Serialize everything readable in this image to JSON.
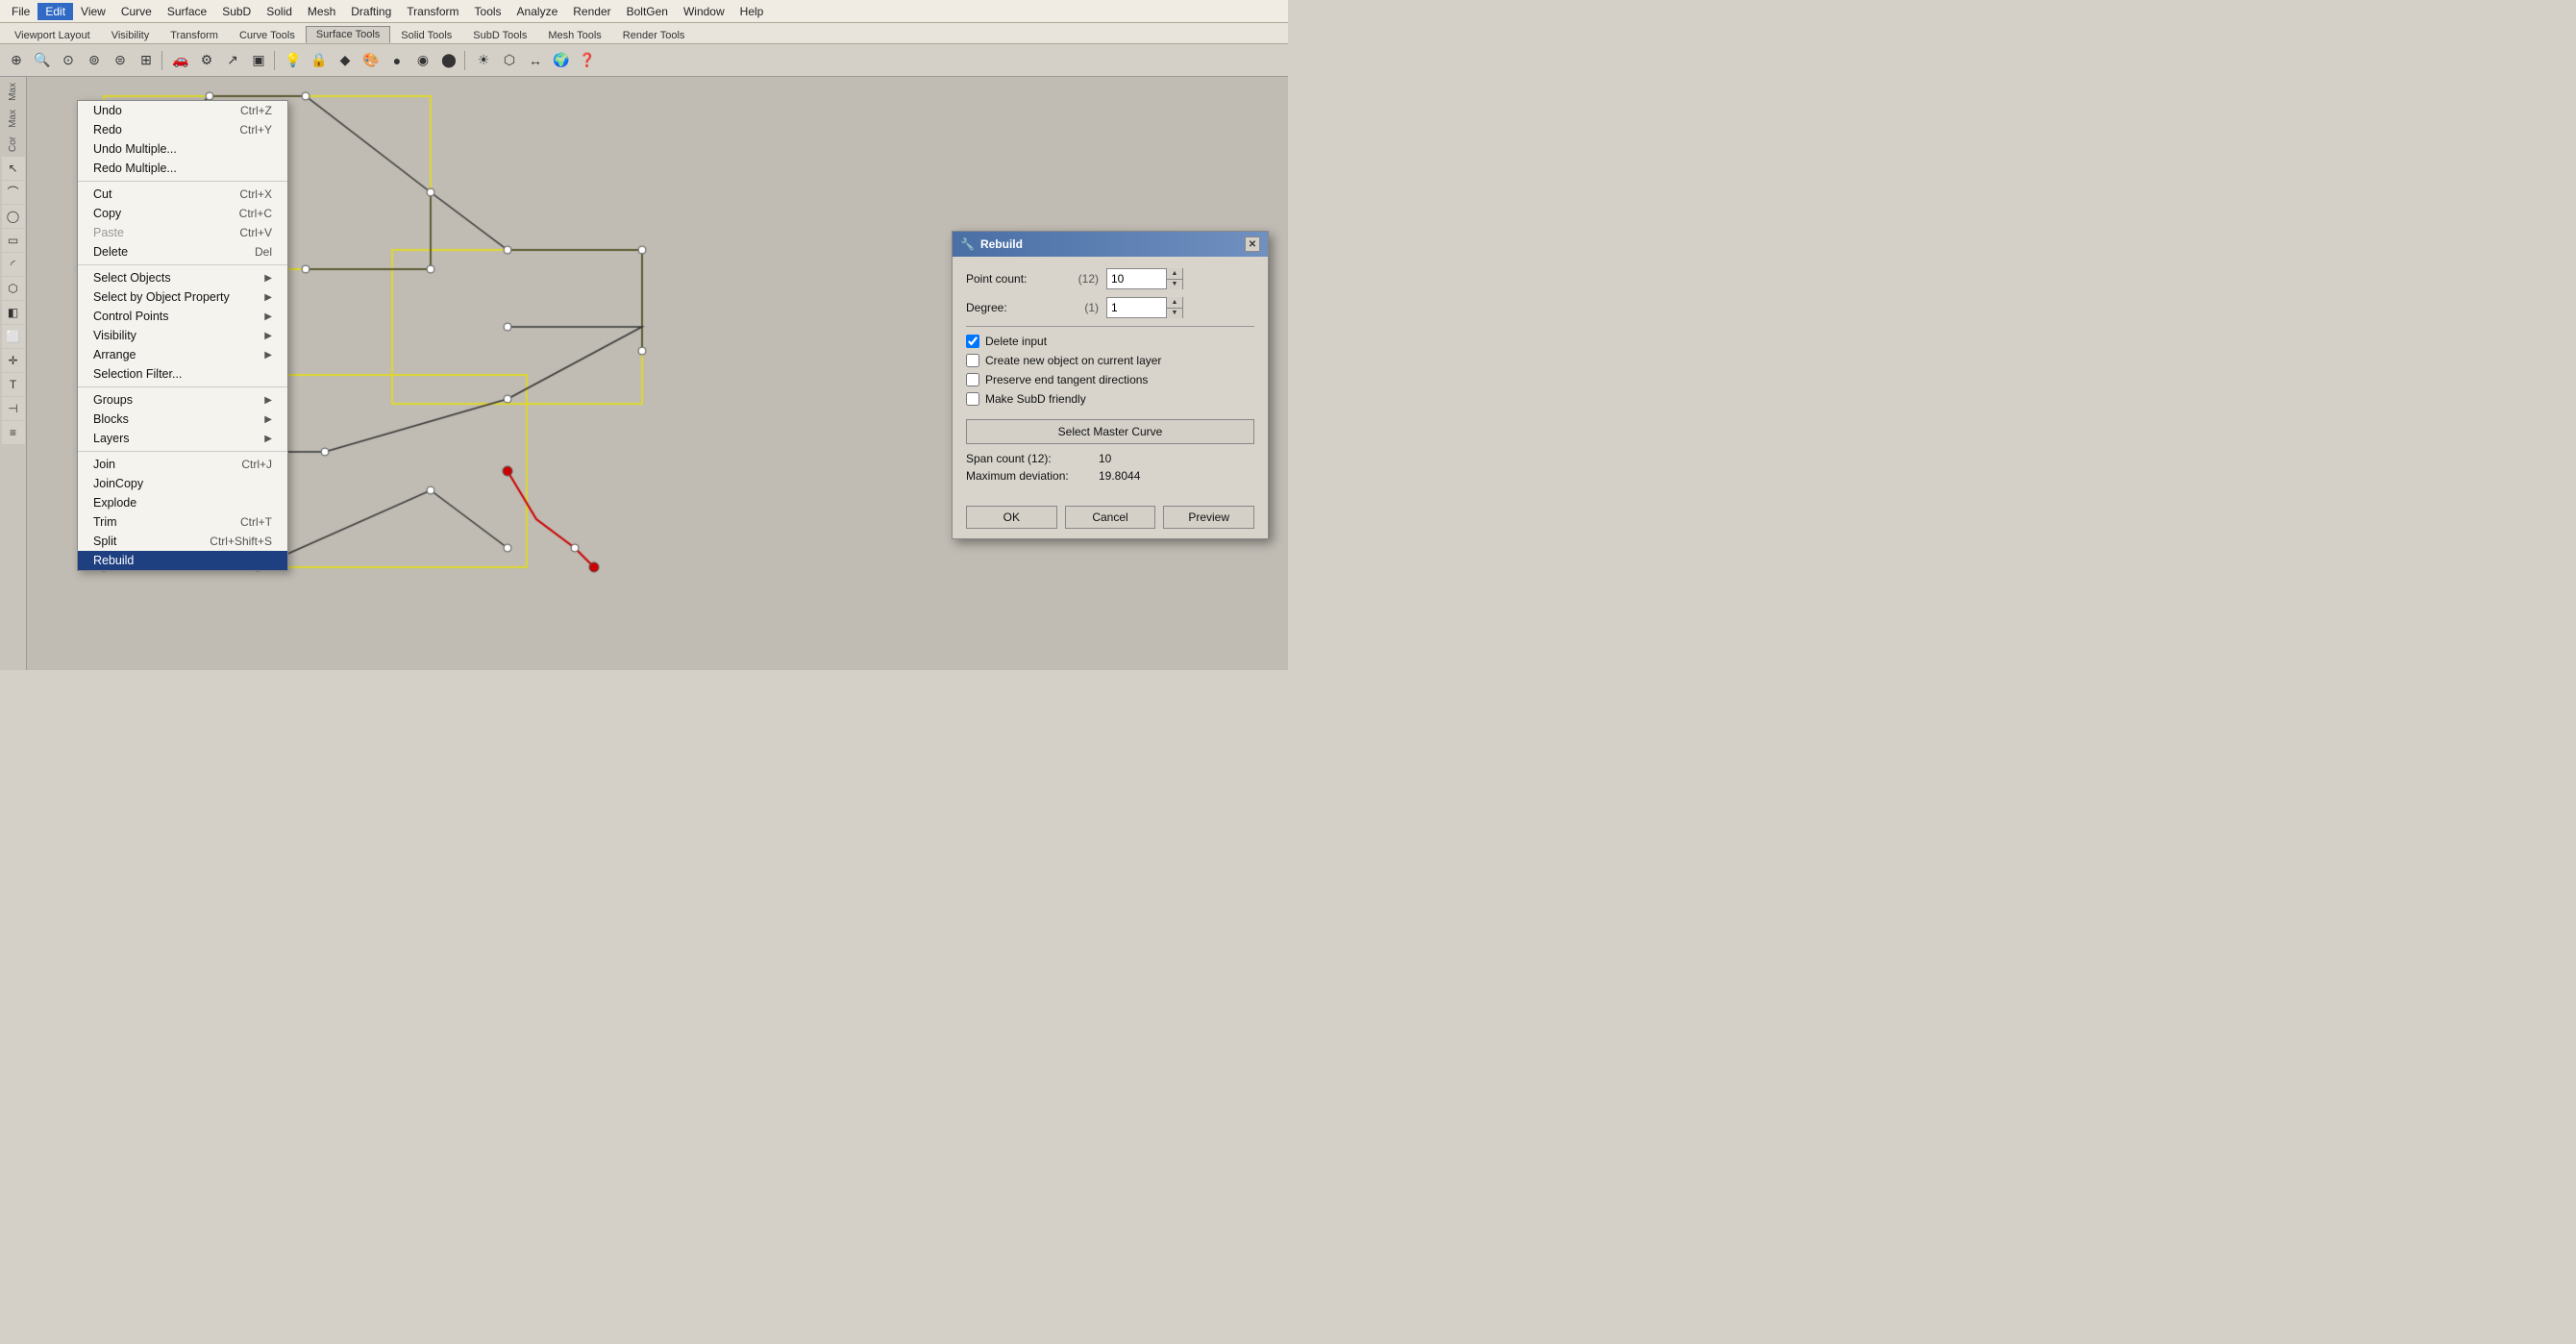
{
  "menubar": {
    "items": [
      "File",
      "Edit",
      "View",
      "Curve",
      "Surface",
      "SubD",
      "Solid",
      "Mesh",
      "Drafting",
      "Transform",
      "Tools",
      "Analyze",
      "Render",
      "BoltGen",
      "Window",
      "Help"
    ]
  },
  "active_menu": "Edit",
  "toolbar_tabs": {
    "items": [
      "Viewport Layout",
      "Visibility",
      "Transform",
      "Curve Tools",
      "Surface Tools",
      "Solid Tools",
      "SubD Tools",
      "Mesh Tools",
      "Render Tools"
    ]
  },
  "left_sidebar": {
    "label_top": "Max",
    "label_top2": "Max",
    "label_top3": "Cor"
  },
  "edit_menu": {
    "items": [
      {
        "label": "Undo",
        "shortcut": "Ctrl+Z",
        "has_arrow": false,
        "disabled": false
      },
      {
        "label": "Redo",
        "shortcut": "Ctrl+Y",
        "has_arrow": false,
        "disabled": false
      },
      {
        "label": "Undo Multiple...",
        "shortcut": "",
        "has_arrow": false,
        "disabled": false
      },
      {
        "label": "Redo Multiple...",
        "shortcut": "",
        "has_arrow": false,
        "disabled": false
      },
      {
        "type": "separator"
      },
      {
        "label": "Cut",
        "shortcut": "Ctrl+X",
        "has_arrow": false,
        "disabled": false
      },
      {
        "label": "Copy",
        "shortcut": "Ctrl+C",
        "has_arrow": false,
        "disabled": false
      },
      {
        "label": "Paste",
        "shortcut": "Ctrl+V",
        "has_arrow": false,
        "disabled": true
      },
      {
        "label": "Delete",
        "shortcut": "Del",
        "has_arrow": false,
        "disabled": false
      },
      {
        "type": "separator"
      },
      {
        "label": "Select Objects",
        "shortcut": "",
        "has_arrow": true,
        "disabled": false
      },
      {
        "label": "Select by Object Property",
        "shortcut": "",
        "has_arrow": true,
        "disabled": false
      },
      {
        "label": "Control Points",
        "shortcut": "",
        "has_arrow": true,
        "disabled": false
      },
      {
        "label": "Visibility",
        "shortcut": "",
        "has_arrow": true,
        "disabled": false
      },
      {
        "label": "Arrange",
        "shortcut": "",
        "has_arrow": true,
        "disabled": false
      },
      {
        "label": "Selection Filter...",
        "shortcut": "",
        "has_arrow": false,
        "disabled": false
      },
      {
        "type": "separator"
      },
      {
        "label": "Groups",
        "shortcut": "",
        "has_arrow": true,
        "disabled": false
      },
      {
        "label": "Blocks",
        "shortcut": "",
        "has_arrow": true,
        "disabled": false
      },
      {
        "label": "Layers",
        "shortcut": "",
        "has_arrow": true,
        "disabled": false
      },
      {
        "type": "separator"
      },
      {
        "label": "Join",
        "shortcut": "Ctrl+J",
        "has_arrow": false,
        "disabled": false
      },
      {
        "label": "JoinCopy",
        "shortcut": "",
        "has_arrow": false,
        "disabled": false
      },
      {
        "label": "Explode",
        "shortcut": "",
        "has_arrow": false,
        "disabled": false
      },
      {
        "label": "Trim",
        "shortcut": "Ctrl+T",
        "has_arrow": false,
        "disabled": false
      },
      {
        "label": "Split",
        "shortcut": "Ctrl+Shift+S",
        "has_arrow": false,
        "disabled": false
      },
      {
        "label": "Rebuild",
        "shortcut": "",
        "has_arrow": false,
        "disabled": false,
        "highlighted": true
      }
    ]
  },
  "rebuild_dialog": {
    "title": "Rebuild",
    "icon": "🔧",
    "point_count_label": "Point count:",
    "point_count_hint": "(12)",
    "point_count_value": "10",
    "degree_label": "Degree:",
    "degree_hint": "(1)",
    "degree_value": "1",
    "delete_input_label": "Delete input",
    "delete_input_checked": true,
    "create_new_object_label": "Create new object on current layer",
    "create_new_object_checked": false,
    "preserve_end_tangent_label": "Preserve end tangent directions",
    "preserve_end_tangent_checked": false,
    "make_subd_friendly_label": "Make SubD friendly",
    "make_subd_friendly_checked": false,
    "select_master_curve_label": "Select Master Curve",
    "span_count_label": "Span count (12):",
    "span_count_value": "10",
    "max_deviation_label": "Maximum deviation:",
    "max_deviation_value": "19.8044",
    "ok_label": "OK",
    "cancel_label": "Cancel",
    "preview_label": "Preview"
  },
  "toolbar_icons": [
    "⊕",
    "🔍",
    "○",
    "↺",
    "↻",
    "⊞",
    "🚗",
    "⚙",
    "↗",
    "□",
    "💡",
    "🔒",
    "◆",
    "🎨",
    "●",
    "◉",
    "⬤",
    "◈",
    "☀",
    "⬡",
    "↔",
    "🌍",
    "❓"
  ]
}
